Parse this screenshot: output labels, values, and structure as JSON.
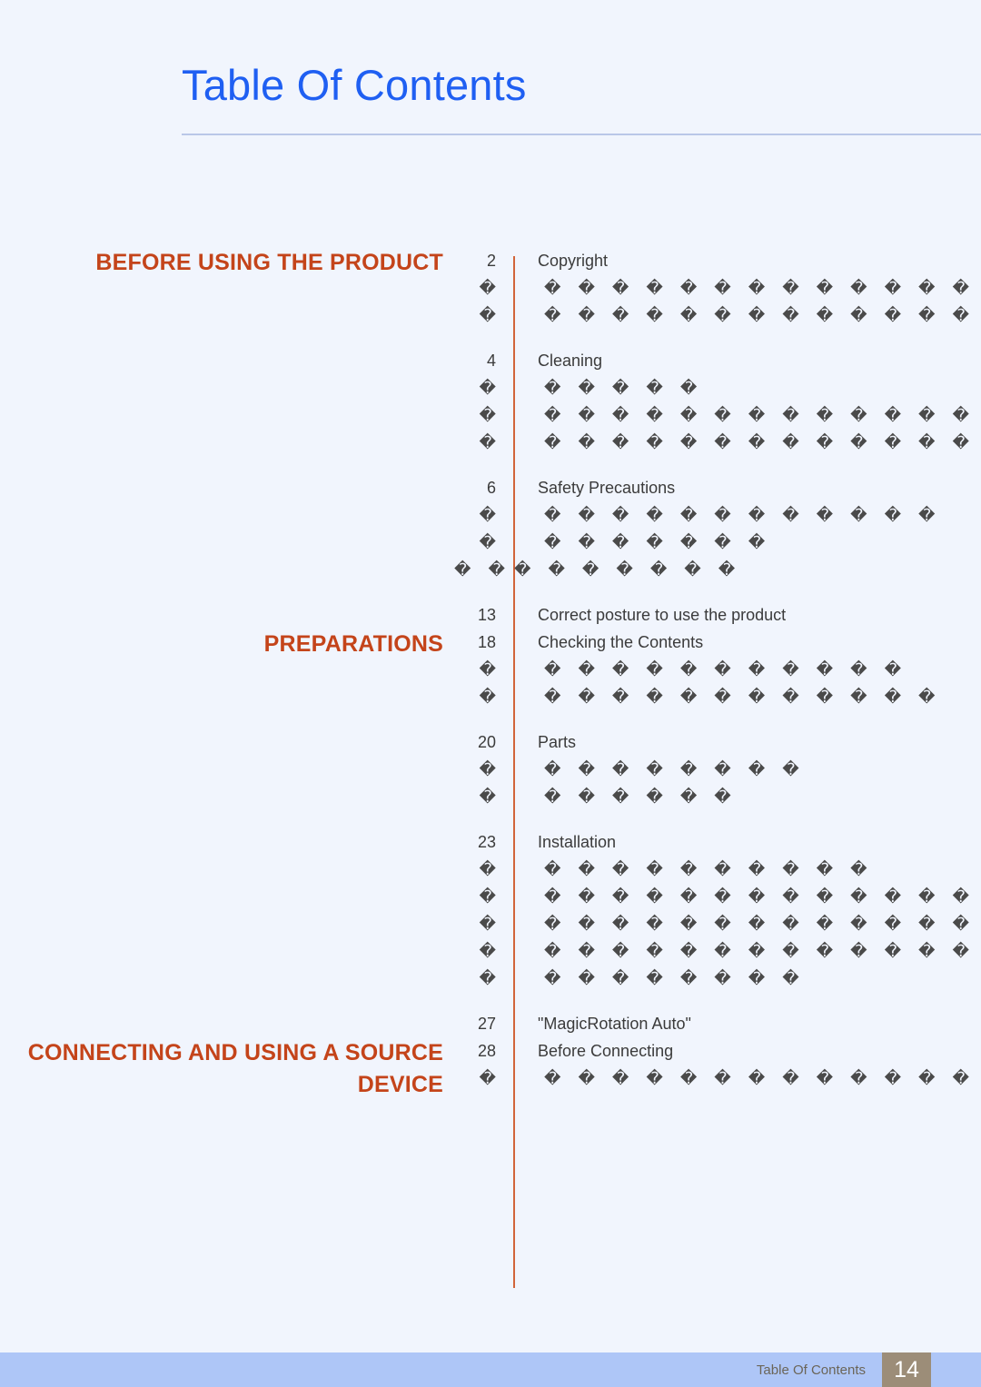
{
  "header": {
    "title": "Table Of Contents"
  },
  "footer": {
    "label": "Table Of Contents",
    "page_number": "14"
  },
  "colors": {
    "page_background": "#f1f5fd",
    "title_blue": "#1f5ff2",
    "heading_orange": "#c4441a",
    "divider_orange": "#d2643a",
    "footer_bar": "#aec6f7",
    "footer_pageno_bg": "#9c8d78",
    "body_text": "#3b3b3b",
    "title_rule": "#b9c7e8"
  },
  "toc": {
    "groups": [
      {
        "heading": "BEFORE USING THE PRODUCT",
        "entries": [
          {
            "page": "2",
            "label": "Copyright",
            "subrows": [
              {
                "page": "�",
                "label": "� � � � � � � � � � � � �"
              },
              {
                "page": "�",
                "label": "� � � � � � � � � � � � � � �"
              }
            ]
          },
          {
            "page": "4",
            "label": "Cleaning",
            "subrows": [
              {
                "page": "�",
                "label": "� � � � �"
              },
              {
                "page": "�",
                "label": "� � � � � � � � � � � � � � � �"
              },
              {
                "page": "�",
                "label": "� � � � � � � � � � � � �"
              }
            ]
          },
          {
            "page": "6",
            "label": "Safety Precautions",
            "subrows": [
              {
                "page": "�",
                "label": "� � � � � � � � � � � �"
              },
              {
                "page": "�",
                "label": "� � � � � � �"
              },
              {
                "page": "� �",
                "label": "� � � � � � �",
                "overflow": true
              }
            ]
          },
          {
            "page": "13",
            "label": "Correct posture to use the product",
            "subrows": []
          }
        ]
      },
      {
        "heading": "PREPARATIONS",
        "entries": [
          {
            "page": "18",
            "label": "Checking the Contents",
            "subrows": [
              {
                "page": "�",
                "label": "� � � � � � � � � � �"
              },
              {
                "page": "�",
                "label": "� � � � � � � � � � � �"
              }
            ]
          },
          {
            "page": "20",
            "label": "Parts",
            "subrows": [
              {
                "page": "�",
                "label": "� � � � � � � �"
              },
              {
                "page": "�",
                "label": "� � � � � �"
              }
            ]
          },
          {
            "page": "23",
            "label": "Installation",
            "subrows": [
              {
                "page": "�",
                "label": "� � � � � � � � � �"
              },
              {
                "page": "�",
                "label": "� � � � � � � � � � � � � � � � � � � � � �"
              },
              {
                "page": "�",
                "label": "� � � � � � � � � � � � � � �"
              },
              {
                "page": "�",
                "label": "� � � � � � � � � � � � � � � � � � � � � � � �"
              },
              {
                "page": "�",
                "label": "� � � � � � � �"
              }
            ]
          },
          {
            "page": "27",
            "label": "\"MagicRotation Auto\"",
            "subrows": []
          }
        ]
      },
      {
        "heading": "CONNECTING AND USING A SOURCE DEVICE",
        "entries": [
          {
            "page": "28",
            "label": "Before Connecting",
            "subrows": [
              {
                "page": "�",
                "label": "� � � � � � � � � � � � � �"
              }
            ]
          }
        ]
      }
    ]
  }
}
